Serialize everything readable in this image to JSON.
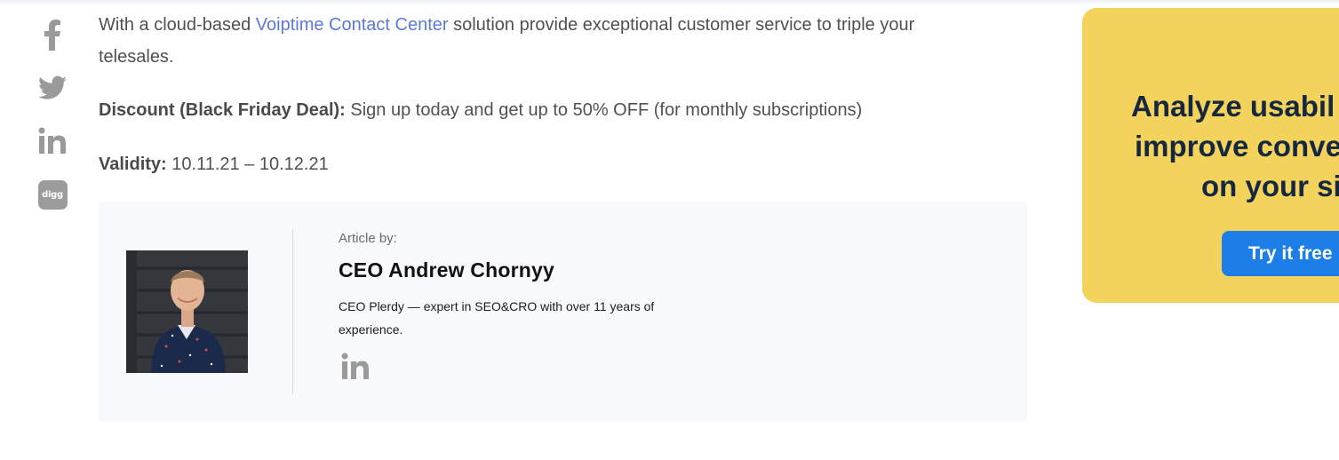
{
  "share": {
    "icons": [
      "facebook-icon",
      "twitter-icon",
      "linkedin-icon",
      "digg-icon"
    ],
    "digg_text": "digg",
    "icon_color": "#9a9a9a"
  },
  "article": {
    "p1_before": "With a cloud-based ",
    "p1_link": "Voiptime Contact Center",
    "p1_after": " solution provide exceptional customer service to triple your telesales.",
    "discount_label": "Discount (Black Friday Deal):",
    "discount_text": " Sign up today and get up to 50% OFF (for monthly subscriptions)",
    "validity_label": "Validity:",
    "validity_text": " 10.11.21 – 10.12.21",
    "link_color": "#5b78db"
  },
  "author": {
    "byline": "Article by:",
    "name": "CEO Andrew Chornyy",
    "description": "CEO Plerdy — expert in SEO&CRO with over 11 years of experience."
  },
  "promo": {
    "line1": "Analyze usabil",
    "line2": "improve conve",
    "line3": "on your si",
    "button": "Try it free",
    "bg_color": "#f3d35c",
    "button_color": "#1d7ee8"
  }
}
